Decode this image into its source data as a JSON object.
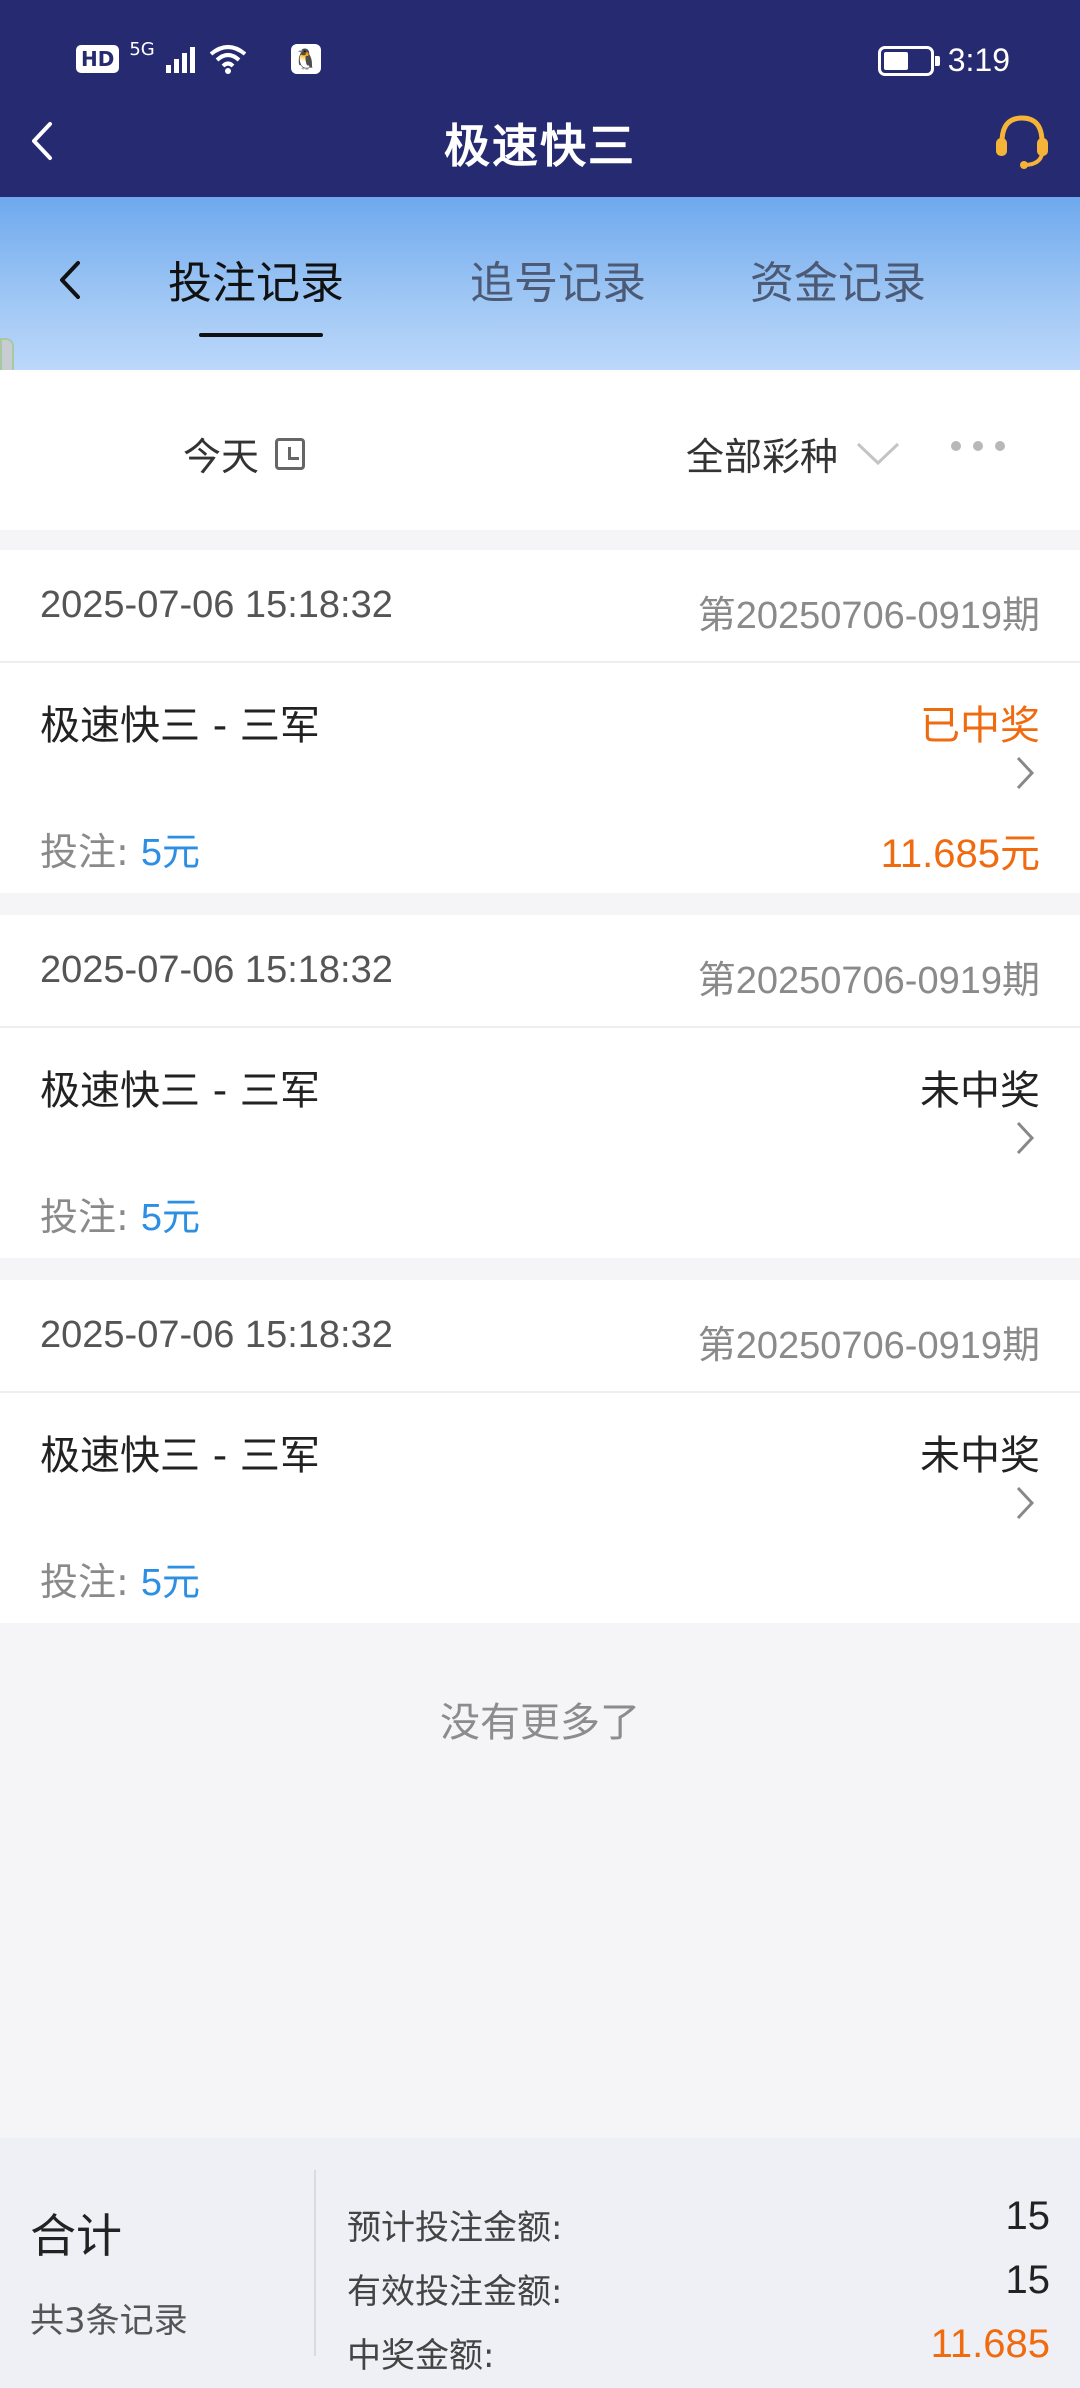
{
  "status_bar": {
    "network_hd": "HD",
    "network_gen": "5G",
    "time": "3:19",
    "battery_level": 0.55,
    "icons": [
      "hd-icon",
      "signal-icon",
      "wifi-icon",
      "qq-icon",
      "battery-icon"
    ]
  },
  "nav": {
    "title": "极速快三",
    "icons": [
      "back-icon",
      "customer-service-icon"
    ],
    "accent_color": "#262a70"
  },
  "tabs": {
    "items": [
      {
        "label": "投注记录",
        "active": true
      },
      {
        "label": "追号记录",
        "active": false
      },
      {
        "label": "资金记录",
        "active": false
      }
    ]
  },
  "filter": {
    "date_label": "今天",
    "lottery_label": "全部彩种",
    "icons": [
      "calendar-icon",
      "chevron-down-icon",
      "more-icon"
    ]
  },
  "records": [
    {
      "time": "2025-07-06 15:18:32",
      "issue": "第20250706-0919期",
      "name": "极速快三 - 三军",
      "status": "已中奖",
      "bet_label": "投注:",
      "bet_amount": "5元",
      "win_amount": "11.685元"
    },
    {
      "time": "2025-07-06 15:18:32",
      "issue": "第20250706-0919期",
      "name": "极速快三 - 三军",
      "status": "未中奖",
      "bet_label": "投注:",
      "bet_amount": "5元",
      "win_amount": ""
    },
    {
      "time": "2025-07-06 15:18:32",
      "issue": "第20250706-0919期",
      "name": "极速快三 - 三军",
      "status": "未中奖",
      "bet_label": "投注:",
      "bet_amount": "5元",
      "win_amount": ""
    }
  ],
  "no_more": "没有更多了",
  "summary": {
    "total_label": "合计",
    "count_label": "共3条记录",
    "rows": [
      {
        "label": "预计投注金额:",
        "value": "15"
      },
      {
        "label": "有效投注金额:",
        "value": "15"
      },
      {
        "label": "中奖金额:",
        "value": "11.685"
      }
    ]
  },
  "colors": {
    "win": "#f06a0f",
    "bet_amount": "#2d8fe3"
  }
}
